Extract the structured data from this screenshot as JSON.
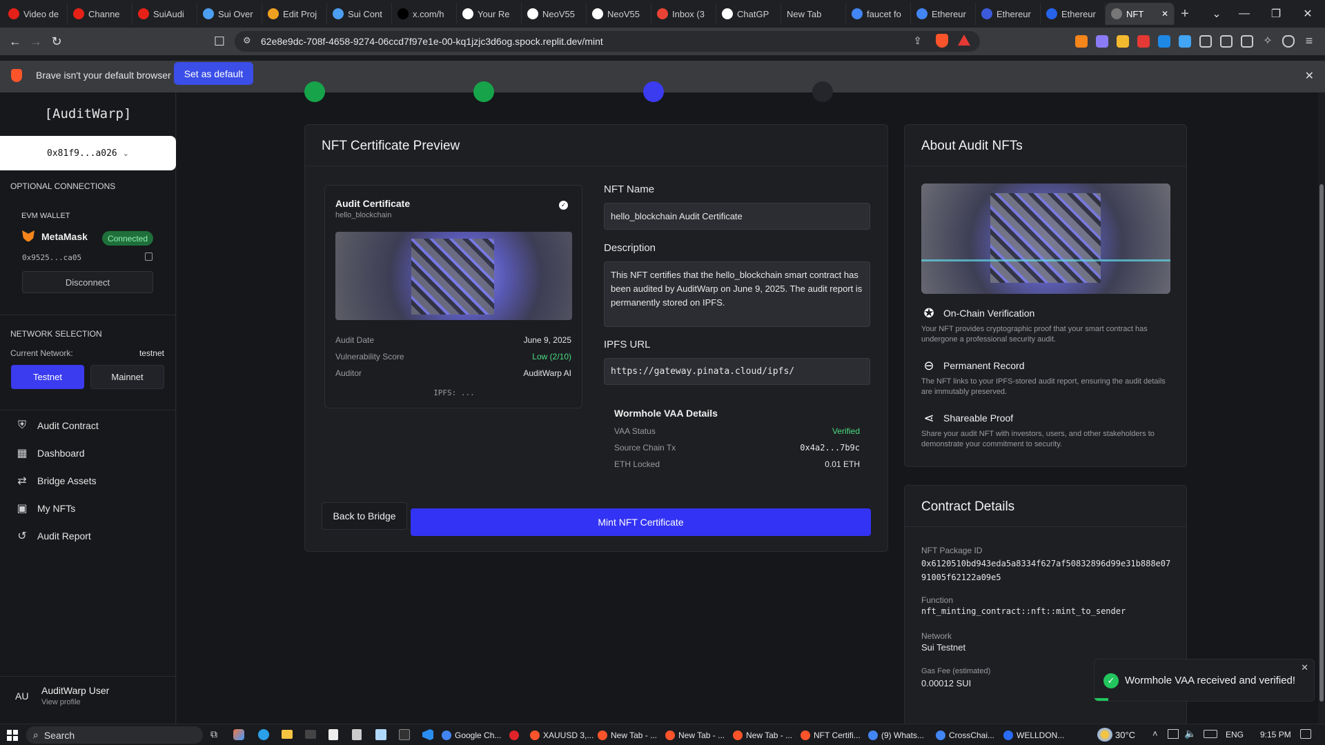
{
  "browser": {
    "tabs": [
      {
        "label": "Video de",
        "icon": "youtube-icon",
        "color": "#e62117"
      },
      {
        "label": "Channe",
        "icon": "youtube-icon",
        "color": "#e62117"
      },
      {
        "label": "SuiAudi",
        "icon": "youtube-icon",
        "color": "#e62117"
      },
      {
        "label": "Sui Over",
        "icon": "sui-icon",
        "color": "#4c9ef0"
      },
      {
        "label": "Edit Proj",
        "icon": "edit-icon",
        "color": "#f0a020"
      },
      {
        "label": "Sui Cont",
        "icon": "sui-icon",
        "color": "#4c9ef0"
      },
      {
        "label": "x.com/h",
        "icon": "x-icon",
        "color": "#000000"
      },
      {
        "label": "Your Re",
        "icon": "github-icon",
        "color": "#ffffff"
      },
      {
        "label": "NeoV55",
        "icon": "github-icon",
        "color": "#ffffff"
      },
      {
        "label": "NeoV55",
        "icon": "github-icon",
        "color": "#ffffff"
      },
      {
        "label": "Inbox (3",
        "icon": "gmail-icon",
        "color": "#ea4335"
      },
      {
        "label": "ChatGP",
        "icon": "chatgpt-icon",
        "color": "#ffffff"
      },
      {
        "label": "New Tab",
        "icon": "",
        "color": ""
      },
      {
        "label": "faucet fo",
        "icon": "google-icon",
        "color": "#4285f4"
      },
      {
        "label": "Ethereur",
        "icon": "google-icon",
        "color": "#4285f4"
      },
      {
        "label": "Ethereur",
        "icon": "ethereum-icon",
        "color": "#3b5bdb"
      },
      {
        "label": "Ethereur",
        "icon": "ethereum-icon",
        "color": "#2563eb"
      },
      {
        "label": "NFT",
        "icon": "globe-icon",
        "color": "#777777",
        "active": true
      }
    ],
    "url": "62e8e9dc-708f-4658-9274-06ccd7f97e1e-00-kq1jzjc3d6og.spock.replit.dev/mint",
    "infobar_text": "Brave isn't your default browser",
    "set_default_label": "Set as default"
  },
  "sidebar": {
    "logo": "[AuditWarp]",
    "wallet_button": "0x81f9...a026",
    "optional_connections": "OPTIONAL CONNECTIONS",
    "evm_wallet": "EVM WALLET",
    "metamask": "MetaMask",
    "connected": "Connected",
    "evm_address": "0x9525...ca05",
    "disconnect": "Disconnect",
    "network_selection": "NETWORK SELECTION",
    "current_network_label": "Current Network:",
    "current_network_value": "testnet",
    "testnet": "Testnet",
    "mainnet": "Mainnet",
    "nav": [
      {
        "label": "Audit Contract",
        "icon": "shield-icon"
      },
      {
        "label": "Dashboard",
        "icon": "dashboard-icon"
      },
      {
        "label": "Bridge Assets",
        "icon": "bridge-icon"
      },
      {
        "label": "My NFTs",
        "icon": "image-icon"
      },
      {
        "label": "Audit Report",
        "icon": "history-icon"
      }
    ],
    "user_initials": "AU",
    "user_name": "AuditWarp User",
    "view_profile": "View profile"
  },
  "preview": {
    "title": "NFT Certificate Preview",
    "cert_title": "Audit Certificate",
    "cert_subtitle": "hello_blockchain",
    "audit_date_label": "Audit Date",
    "audit_date": "June 9, 2025",
    "vuln_label": "Vulnerability Score",
    "vuln_value": "Low (2/10)",
    "auditor_label": "Auditor",
    "auditor_value": "AuditWarp AI",
    "ipfs_short": "IPFS: ...",
    "nft_name_label": "NFT Name",
    "nft_name": "hello_blockchain Audit Certificate",
    "description_label": "Description",
    "description": "This NFT certifies that the hello_blockchain smart contract has been audited by AuditWarp on June 9, 2025. The audit report is permanently stored on IPFS.",
    "ipfs_label": "IPFS URL",
    "ipfs_url": "https://gateway.pinata.cloud/ipfs/",
    "vaa_title": "Wormhole VAA Details",
    "vaa_status_label": "VAA Status",
    "vaa_status": "Verified",
    "source_tx_label": "Source Chain Tx",
    "source_tx": "0x4a2...7b9c",
    "eth_locked_label": "ETH Locked",
    "eth_locked": "0.01 ETH",
    "back_button": "Back to Bridge",
    "mint_button": "Mint NFT Certificate"
  },
  "about": {
    "title": "About Audit NFTs",
    "features": [
      {
        "title": "On-Chain Verification",
        "text": "Your NFT provides cryptographic proof that your smart contract has undergone a professional security audit.",
        "icon": "verified-badge-icon"
      },
      {
        "title": "Permanent Record",
        "text": "The NFT links to your IPFS-stored audit report, ensuring the audit details are immutably preserved.",
        "icon": "link-icon"
      },
      {
        "title": "Shareable Proof",
        "text": "Share your audit NFT with investors, users, and other stakeholders to demonstrate your commitment to security.",
        "icon": "share-icon"
      }
    ]
  },
  "contract": {
    "title": "Contract Details",
    "package_label": "NFT Package ID",
    "package_id": "0x6120510bd943eda5a8334f627af50832896d99e31b888e0791005f62122a09e5",
    "function_label": "Function",
    "function": "nft_minting_contract::nft::mint_to_sender",
    "network_label": "Network",
    "network": "Sui Testnet",
    "gas_label": "Gas Fee (estimated)",
    "gas": "0.00012 SUI"
  },
  "toast": {
    "message": "Wormhole VAA received and verified!"
  },
  "taskbar": {
    "search": "Search",
    "items": [
      {
        "label": "Google Ch...",
        "color": "#4285f4"
      },
      {
        "label": "",
        "color": "#e0242a"
      },
      {
        "label": "XAUUSD 3,...",
        "color": "#fb542b"
      },
      {
        "label": "New Tab - ...",
        "color": "#fb542b"
      },
      {
        "label": "New Tab - ...",
        "color": "#fb542b"
      },
      {
        "label": "New Tab - ...",
        "color": "#fb542b"
      },
      {
        "label": "NFT Certifi...",
        "color": "#fb542b"
      },
      {
        "label": "(9) Whats...",
        "color": "#4285f4"
      },
      {
        "label": "CrossChai...",
        "color": "#4285f4"
      },
      {
        "label": "WELLDON...",
        "color": "#2b6cf6"
      }
    ],
    "weather": "30°C",
    "lang": "ENG",
    "time": "9:15 PM"
  },
  "colors": {
    "accent": "#3b3bf0",
    "green": "#22c55e",
    "connected_bg": "#1f6f3a"
  }
}
